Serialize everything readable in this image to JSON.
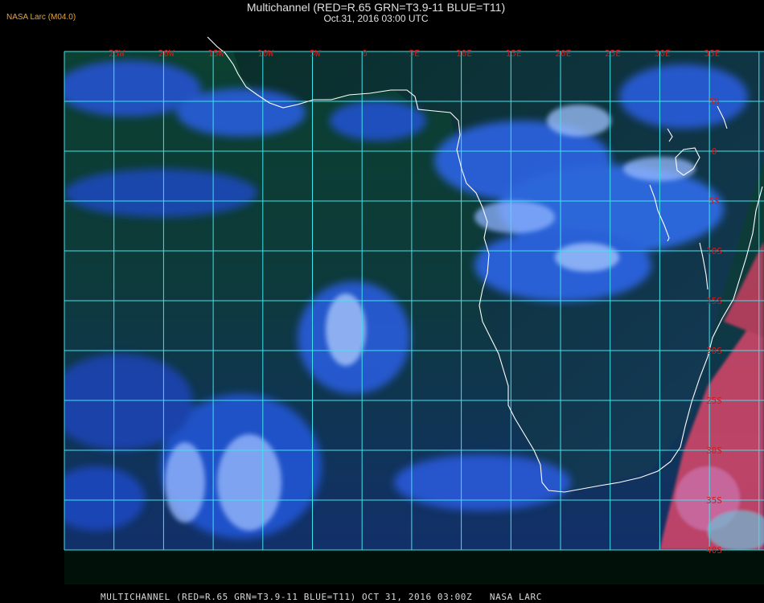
{
  "header": {
    "credit": "NASA Larc (M04.0)",
    "title": "Multichannel (RED=R.65 GRN=T3.9-11 BLUE=T11)",
    "subtitle": "Oct.31, 2016 03:00 UTC"
  },
  "map": {
    "longitude_labels": [
      "25W",
      "20W",
      "15W",
      "10W",
      "5W",
      "0",
      "5E",
      "10E",
      "15E",
      "20E",
      "25E",
      "30E",
      "35E"
    ],
    "latitude_labels": [
      "5N",
      "0",
      "5S",
      "10S",
      "15S",
      "20S",
      "25S",
      "30S",
      "35S",
      "40S"
    ],
    "colors": {
      "grid": "#3fe3ea",
      "coast": "#ffffff",
      "label": "#d21a1a",
      "ocean_dark": "#0b3a2e",
      "cloud_blue": "#2f6cf2",
      "cloud_light": "#b8d3ff",
      "land_red": "#e0506b"
    }
  },
  "footer": {
    "text": "MULTICHANNEL (RED=R.65 GRN=T3.9-11 BLUE=T11) OCT 31, 2016 03:00Z   NASA LARC"
  }
}
